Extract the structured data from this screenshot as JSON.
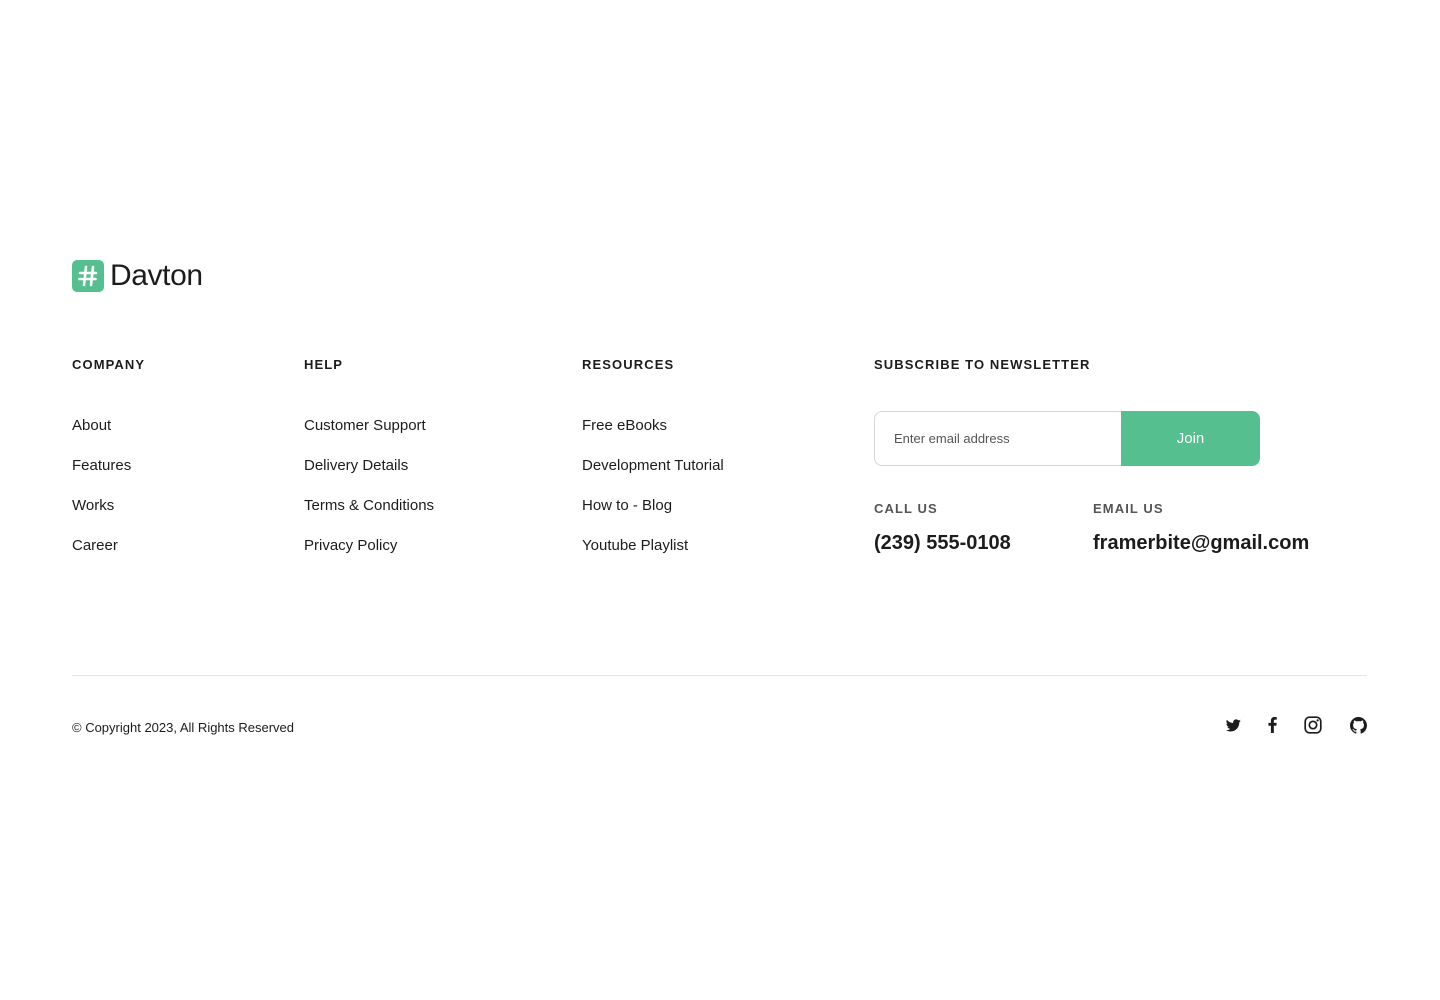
{
  "brand": {
    "name": "Davton",
    "mark_glyph": "#",
    "accent_color": "#55bf8f"
  },
  "columns": {
    "company": {
      "heading": "COMPANY",
      "links": [
        "About",
        "Features",
        "Works",
        "Career"
      ]
    },
    "help": {
      "heading": "HELP",
      "links": [
        "Customer Support",
        "Delivery Details",
        "Terms & Conditions",
        "Privacy Policy"
      ]
    },
    "resources": {
      "heading": "RESOURCES",
      "links": [
        "Free eBooks",
        "Development Tutorial",
        "How to - Blog",
        "Youtube Playlist"
      ]
    }
  },
  "newsletter": {
    "heading": "SUBSCRIBE TO NEWSLETTER",
    "placeholder": "Enter email address",
    "button_label": "Join"
  },
  "contact": {
    "call_label": "CALL US",
    "phone": "(239) 555-0108",
    "email_label": "EMAIL US",
    "email": "framerbite@gmail.com"
  },
  "footer": {
    "copyright": "© Copyright 2023, All Rights Reserved",
    "social_icons": [
      "twitter-icon",
      "facebook-icon",
      "instagram-icon",
      "github-icon"
    ]
  }
}
